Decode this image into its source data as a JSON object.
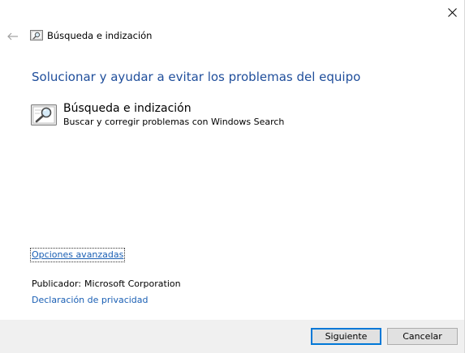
{
  "window": {
    "header_title": "Búsqueda e indización"
  },
  "main": {
    "heading": "Solucionar y ayudar a evitar los problemas del equipo",
    "item": {
      "title": "Búsqueda e indización",
      "description": "Buscar y corregir problemas con Windows Search",
      "icon": "search-indexing-icon"
    }
  },
  "links": {
    "advanced": "Opciones avanzadas",
    "privacy": "Declaración de privacidad"
  },
  "publisher": {
    "label": "Publicador:",
    "value": "Microsoft Corporation"
  },
  "buttons": {
    "next": "Siguiente",
    "cancel": "Cancelar"
  },
  "colors": {
    "heading": "#1f4e9b",
    "link": "#1a5fb4",
    "footer_bg": "#f0f0f0",
    "default_button_border": "#0078d7"
  }
}
